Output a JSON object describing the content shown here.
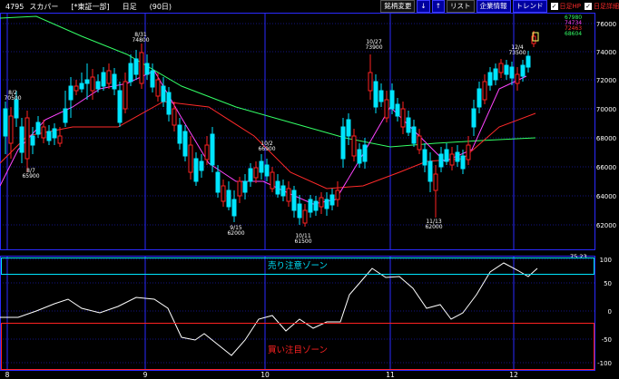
{
  "header": {
    "code": "4795",
    "name": "スカパー",
    "market": "[*東証一部]",
    "period": "日足",
    "days": "(90日)",
    "buttons": [
      "銘柄変更",
      "↓",
      "↑",
      "リスト",
      "企業情報",
      "トレンド"
    ],
    "checks": [
      "日足HP",
      "日足詳細"
    ]
  },
  "price_axis": [
    "76000",
    "74000",
    "72000",
    "70000",
    "68000",
    "66000",
    "64000",
    "62000"
  ],
  "ma_legend": [
    {
      "text": "67980",
      "color": "#33ff66"
    },
    {
      "text": "74734",
      "color": "#ff44ff"
    },
    {
      "text": "72463",
      "color": "#ff3333"
    },
    {
      "text": "68604",
      "color": "#33ff66"
    }
  ],
  "annotations": [
    {
      "date": "8/2",
      "price": "70500"
    },
    {
      "date": "8/7",
      "price": "65900"
    },
    {
      "date": "8/31",
      "price": "74800"
    },
    {
      "date": "9/15",
      "price": "62000"
    },
    {
      "date": "10/2",
      "price": "66900"
    },
    {
      "date": "10/11",
      "price": "61500"
    },
    {
      "date": "10/27",
      "price": "73900"
    },
    {
      "date": "11/13",
      "price": "62000"
    },
    {
      "date": "12/4",
      "price": "73500"
    }
  ],
  "osc_axis": [
    "100",
    "50",
    "0",
    "-50",
    "-100"
  ],
  "osc_value": "75.23",
  "zones": {
    "sell": "売り注意ゾーン",
    "buy": "買い注目ゾーン"
  },
  "months": [
    "8",
    "9",
    "10",
    "11",
    "12"
  ],
  "colors": {
    "up": "#00e5ff",
    "down": "#ff2222",
    "ma_short": "#ff44ff",
    "ma_mid": "#ff2a2a",
    "ma_long": "#33ff66",
    "grid": "#2a2aff"
  }
}
